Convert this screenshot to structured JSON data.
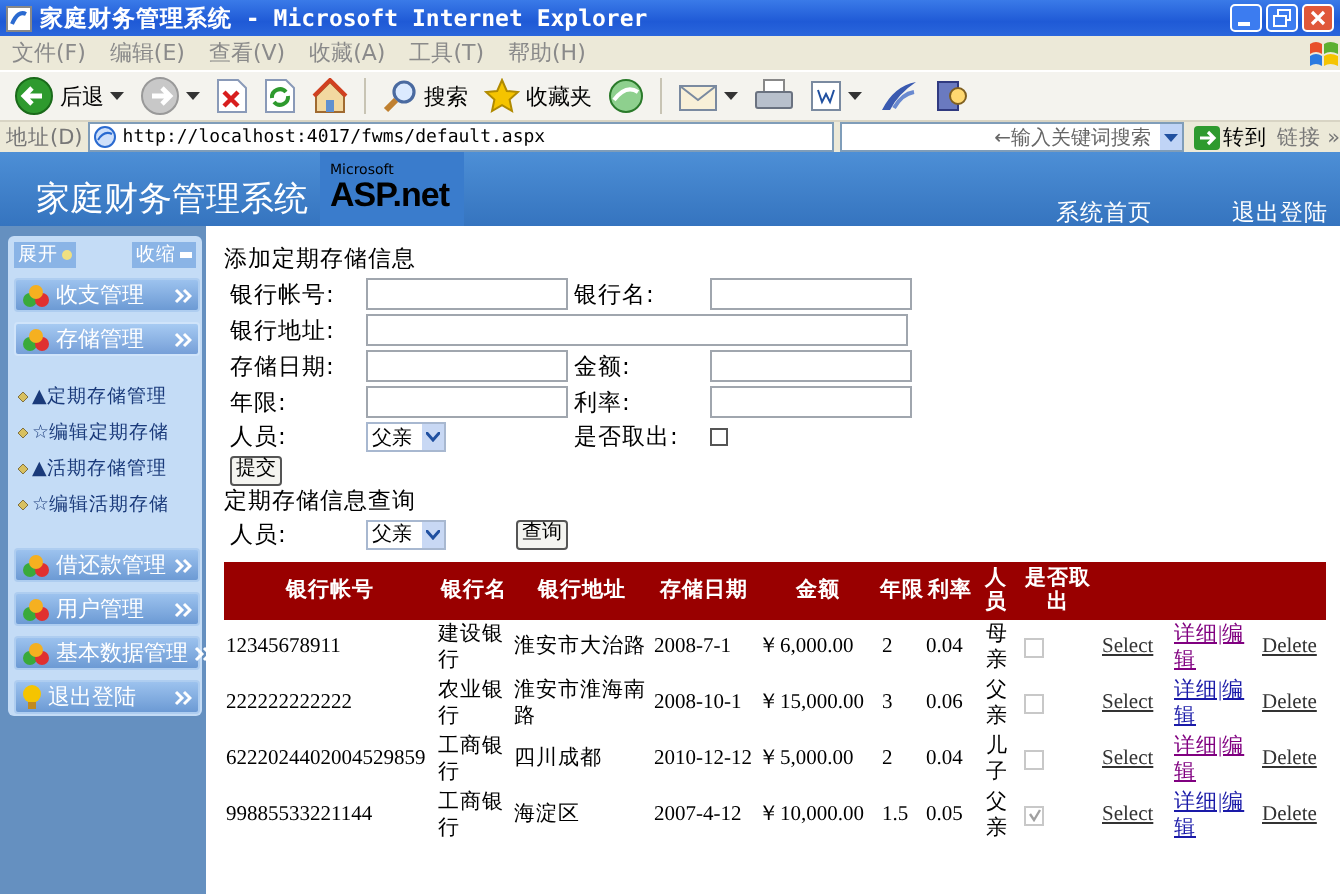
{
  "window": {
    "title": "家庭财务管理系统 - Microsoft Internet Explorer"
  },
  "menu": [
    "文件(F)",
    "编辑(E)",
    "查看(V)",
    "收藏(A)",
    "工具(T)",
    "帮助(H)"
  ],
  "toolbar": [
    {
      "kind": "back",
      "label": "后退",
      "dropdown": true
    },
    {
      "kind": "forward",
      "dropdown": true
    },
    {
      "kind": "stop",
      "dropdown": false
    },
    {
      "kind": "refresh",
      "dropdown": false
    },
    {
      "kind": "home",
      "dropdown": false
    },
    {
      "kind": "search",
      "label": "搜索",
      "dropdown": false
    },
    {
      "kind": "favorites",
      "label": "收藏夹",
      "dropdown": false
    },
    {
      "kind": "media",
      "dropdown": false
    },
    {
      "kind": "mail",
      "dropdown": true
    },
    {
      "kind": "print",
      "dropdown": false
    },
    {
      "kind": "edit",
      "dropdown": true
    },
    {
      "kind": "messenger",
      "dropdown": false
    },
    {
      "kind": "research",
      "dropdown": false
    }
  ],
  "address": {
    "label": "地址(D)",
    "url": "http://localhost:4017/fwms/default.aspx",
    "search_placeholder": "←输入关键词搜索",
    "go": "转到",
    "links": "链接",
    "more": "»"
  },
  "header": {
    "title": "家庭财务管理系统",
    "logo_small": "Microsoft",
    "logo": "ASP.net",
    "nav": [
      "系统首页",
      "退出登陆"
    ]
  },
  "sidebar": {
    "expand": "展开",
    "collapse": "收缩",
    "groups": [
      {
        "label": "收支管理",
        "kind": "balls",
        "expanded": false
      },
      {
        "label": "存储管理",
        "kind": "balls",
        "expanded": true,
        "children": [
          "▲定期存储管理",
          "☆编辑定期存储",
          "▲活期存储管理",
          "☆编辑活期存储"
        ]
      },
      {
        "label": "借还款管理",
        "kind": "balls",
        "expanded": false
      },
      {
        "label": "用户管理",
        "kind": "balls",
        "expanded": false
      },
      {
        "label": "基本数据管理",
        "kind": "balls",
        "expanded": false
      },
      {
        "label": "退出登陆",
        "kind": "bulb",
        "expanded": false
      }
    ]
  },
  "form": {
    "title": "添加定期存储信息",
    "rows": [
      [
        {
          "label": "银行帐号:",
          "kind": "text"
        },
        {
          "label": "银行名:",
          "kind": "text"
        }
      ],
      [
        {
          "label": "银行地址:",
          "kind": "wide"
        }
      ],
      [
        {
          "label": "存储日期:",
          "kind": "text"
        },
        {
          "label": "金额:",
          "kind": "text"
        }
      ],
      [
        {
          "label": "年限:",
          "kind": "text"
        },
        {
          "label": "利率:",
          "kind": "text"
        }
      ],
      [
        {
          "label": "人员:",
          "kind": "select",
          "value": "父亲"
        },
        {
          "label": "是否取出:",
          "kind": "checkbox",
          "checked": false
        }
      ]
    ],
    "submit": "提交"
  },
  "query": {
    "title": "定期存储信息查询",
    "label": "人员:",
    "value": "父亲",
    "button": "查询"
  },
  "table": {
    "columns": [
      "银行帐号",
      "银行名",
      "银行地址",
      "存储日期",
      "金额",
      "年限",
      "利率",
      "人员",
      "是否取出"
    ],
    "rows": [
      {
        "account": "12345678911",
        "bank": "建设银行",
        "address": "淮安市大治路",
        "date": "2008-7-1",
        "amount": "￥6,000.00",
        "years": "2",
        "rate": "0.04",
        "person": "母亲",
        "withdrawn": false,
        "select": "Select",
        "edit": "详细|编辑",
        "edit_visited": true,
        "delete": "Delete"
      },
      {
        "account": "222222222222",
        "bank": "农业银行",
        "address": "淮安市淮海南路",
        "date": "2008-10-1",
        "amount": "￥15,000.00",
        "years": "3",
        "rate": "0.06",
        "person": "父亲",
        "withdrawn": false,
        "select": "Select",
        "edit": "详细|编辑",
        "edit_visited": false,
        "delete": "Delete"
      },
      {
        "account": "6222024402004529859",
        "bank": "工商银行",
        "address": "四川成都",
        "date": "2010-12-12",
        "amount": "￥5,000.00",
        "years": "2",
        "rate": "0.04",
        "person": "儿子",
        "withdrawn": false,
        "select": "Select",
        "edit": "详细|编辑",
        "edit_visited": true,
        "delete": "Delete"
      },
      {
        "account": "99885533221144",
        "bank": "工商银行",
        "address": "海淀区",
        "date": "2007-4-12",
        "amount": "￥10,000.00",
        "years": "1.5",
        "rate": "0.05",
        "person": "父亲",
        "withdrawn": true,
        "select": "Select",
        "edit": "详细|编辑",
        "edit_visited": false,
        "delete": "Delete"
      }
    ]
  }
}
